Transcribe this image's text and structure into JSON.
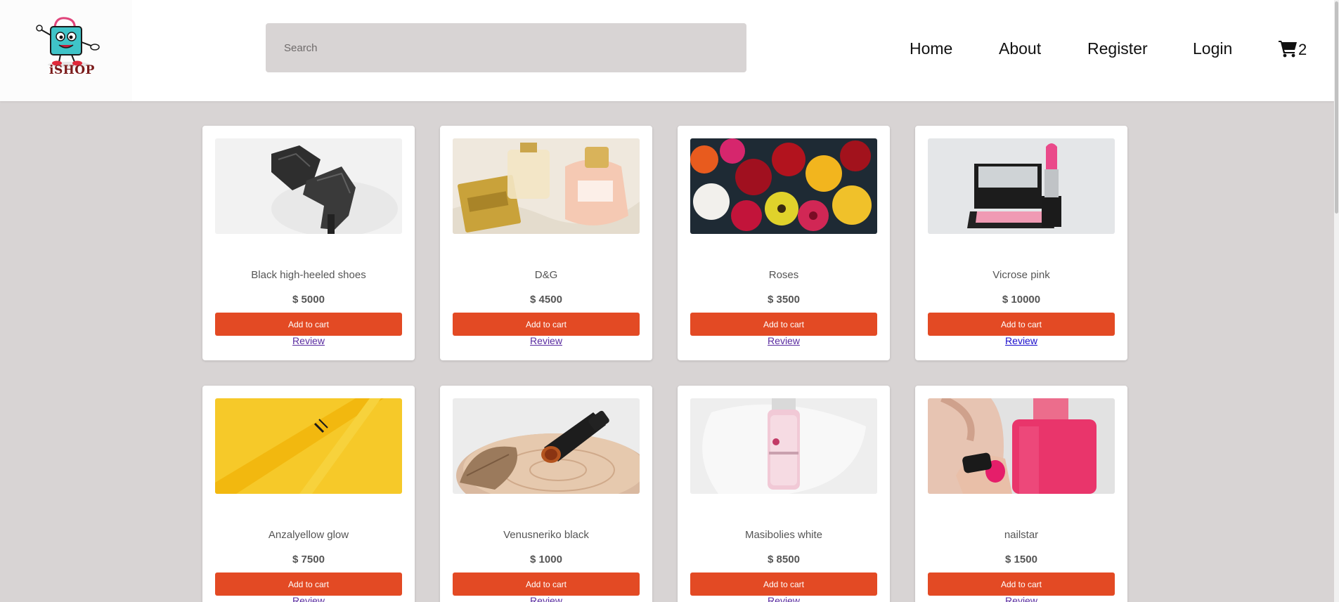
{
  "brand": {
    "logo_text": "iSHOP"
  },
  "search": {
    "placeholder": "Search",
    "value": ""
  },
  "nav": {
    "home": "Home",
    "about": "About",
    "register": "Register",
    "login": "Login"
  },
  "cart": {
    "count": "2",
    "icon": "shopping-cart-icon"
  },
  "colors": {
    "accent": "#e34a24",
    "page_bg": "#d8d4d4",
    "search_bg": "#d8d4d4"
  },
  "products": [
    {
      "name": "Black high-heeled shoes",
      "price": "$ 5000",
      "add_label": "Add to cart",
      "review_label": "Review",
      "image": "black-boots-image"
    },
    {
      "name": "D&G",
      "price": "$ 4500",
      "add_label": "Add to cart",
      "review_label": "Review",
      "image": "perfume-bottles-image"
    },
    {
      "name": "Roses",
      "price": "$ 3500",
      "add_label": "Add to cart",
      "review_label": "Review",
      "image": "rose-bouquet-image"
    },
    {
      "name": "Vicrose pink",
      "price": "$ 10000",
      "add_label": "Add to cart",
      "review_label": "Review",
      "image": "pink-lipstick-image"
    },
    {
      "name": "Anzalyellow glow",
      "price": "$ 7500",
      "add_label": "Add to cart",
      "review_label": "Review",
      "image": "yellow-pen-image"
    },
    {
      "name": "Venusneriko black",
      "price": "$ 1000",
      "add_label": "Add to cart",
      "review_label": "Review",
      "image": "black-lipstick-image"
    },
    {
      "name": "Masibolies white",
      "price": "$ 8500",
      "add_label": "Add to cart",
      "review_label": "Review",
      "image": "white-serum-bottle-image"
    },
    {
      "name": "nailstar",
      "price": "$ 1500",
      "add_label": "Add to cart",
      "review_label": "Review",
      "image": "nail-polish-image"
    }
  ]
}
